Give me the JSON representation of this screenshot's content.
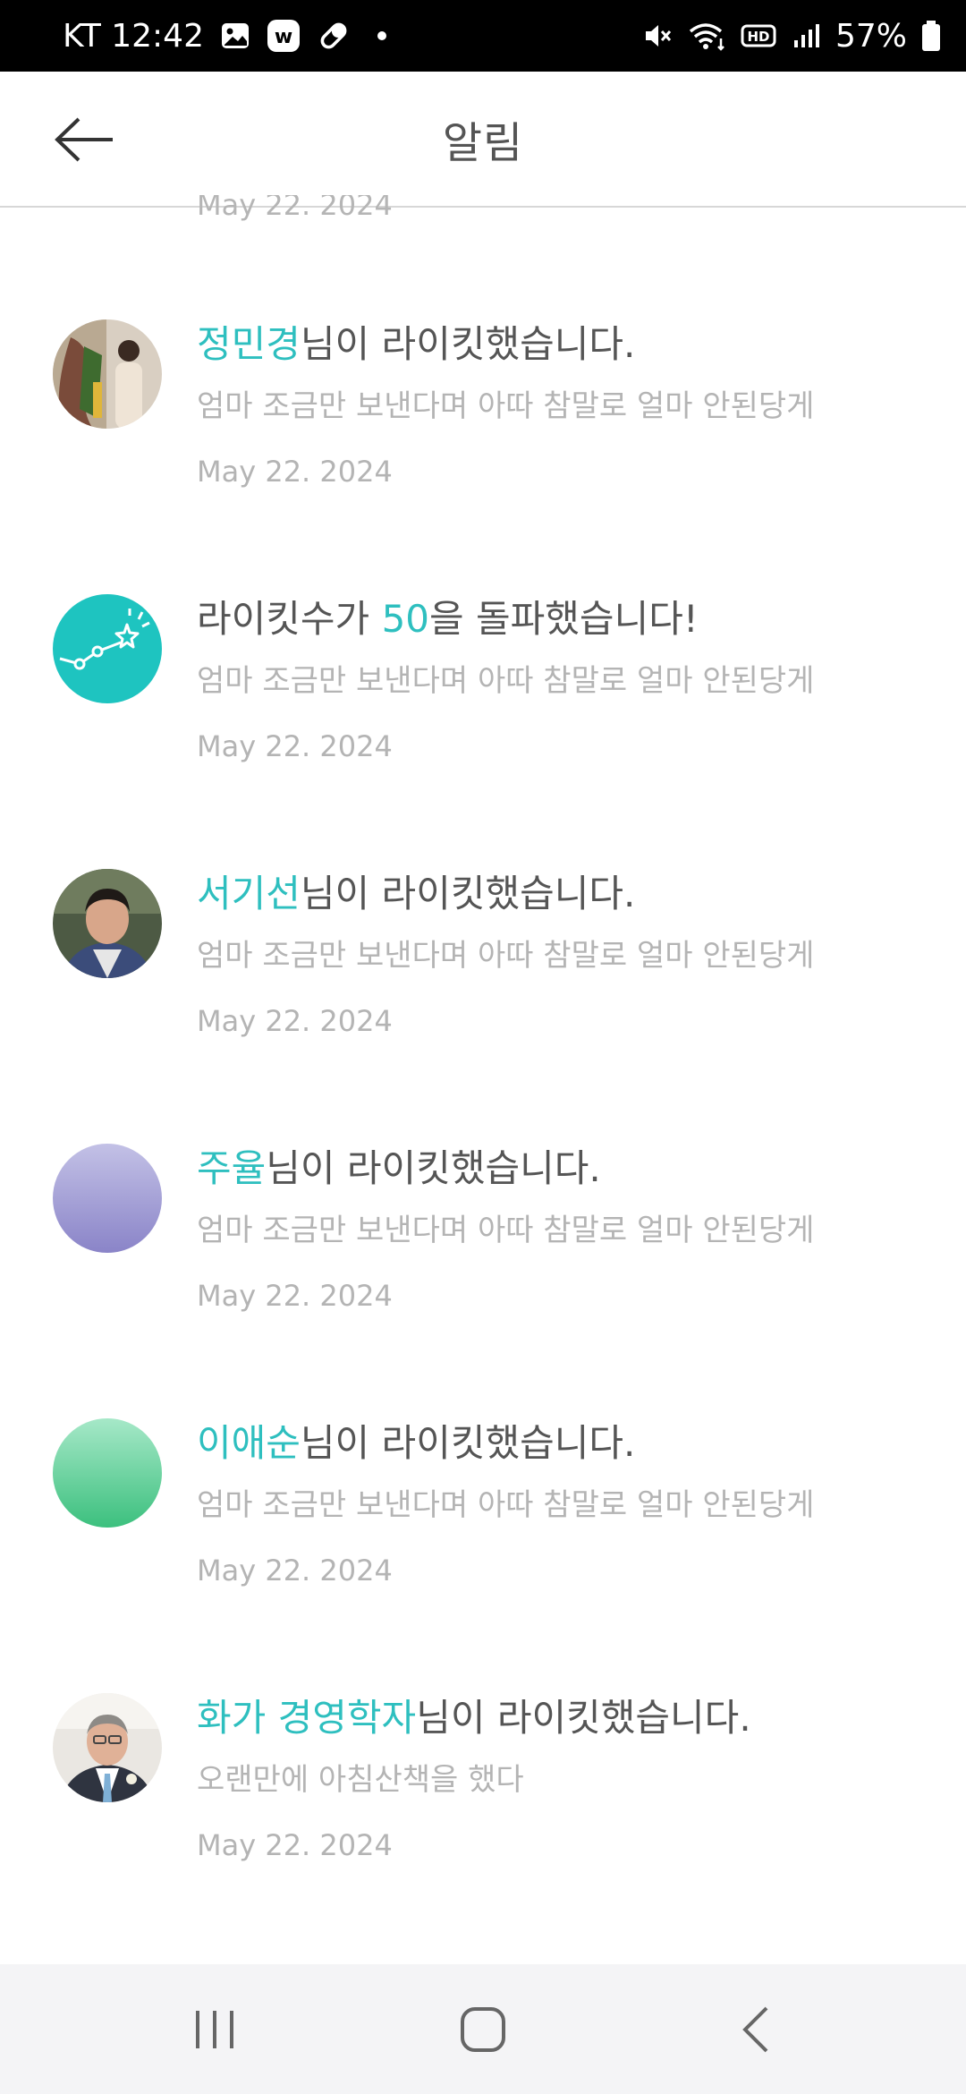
{
  "status_bar": {
    "carrier_time": "KT 12:42",
    "battery": "57%"
  },
  "header": {
    "title": "알림"
  },
  "partial_date": "May 22. 2024",
  "notifications": [
    {
      "name": "정민경",
      "suffix": "님이 라이킷했습니다.",
      "preview": "엄마 조금만 보낸다며 아따 참말로 얼마 안된당게",
      "date": "May 22. 2024",
      "avatar": "photo"
    },
    {
      "prefix": "라이킷수가 ",
      "number": "50",
      "suffix": "을 돌파했습니다!",
      "preview": "엄마 조금만 보낸다며 아따 참말로 얼마 안된당게",
      "date": "May 22. 2024",
      "avatar": "chart-star-icon",
      "avatar_color": "#1ec4c0"
    },
    {
      "name": "서기선",
      "suffix": "님이 라이킷했습니다.",
      "preview": "엄마 조금만 보낸다며 아따 참말로 얼마 안된당게",
      "date": "May 22. 2024",
      "avatar": "photo"
    },
    {
      "name": "주율",
      "suffix": "님이 라이킷했습니다.",
      "preview": "엄마 조금만 보낸다며 아따 참말로 얼마 안된당게",
      "date": "May 22. 2024",
      "avatar": "purple-gradient"
    },
    {
      "name": "이애순",
      "suffix": "님이 라이킷했습니다.",
      "preview": "엄마 조금만 보낸다며 아따 참말로 얼마 안된당게",
      "date": "May 22. 2024",
      "avatar": "green-gradient"
    },
    {
      "name": "화가 경영학자",
      "suffix": "님이 라이킷했습니다.",
      "preview": "오랜만에 아침산책을 했다",
      "date": "May 22. 2024",
      "avatar": "photo"
    }
  ],
  "colors": {
    "accent": "#2ebfbf",
    "title_text": "#555555",
    "muted_text": "#b4b4b4"
  },
  "nav": {
    "recent_icon": "recent-apps-icon",
    "home_icon": "home-icon",
    "back_icon": "back-icon"
  }
}
